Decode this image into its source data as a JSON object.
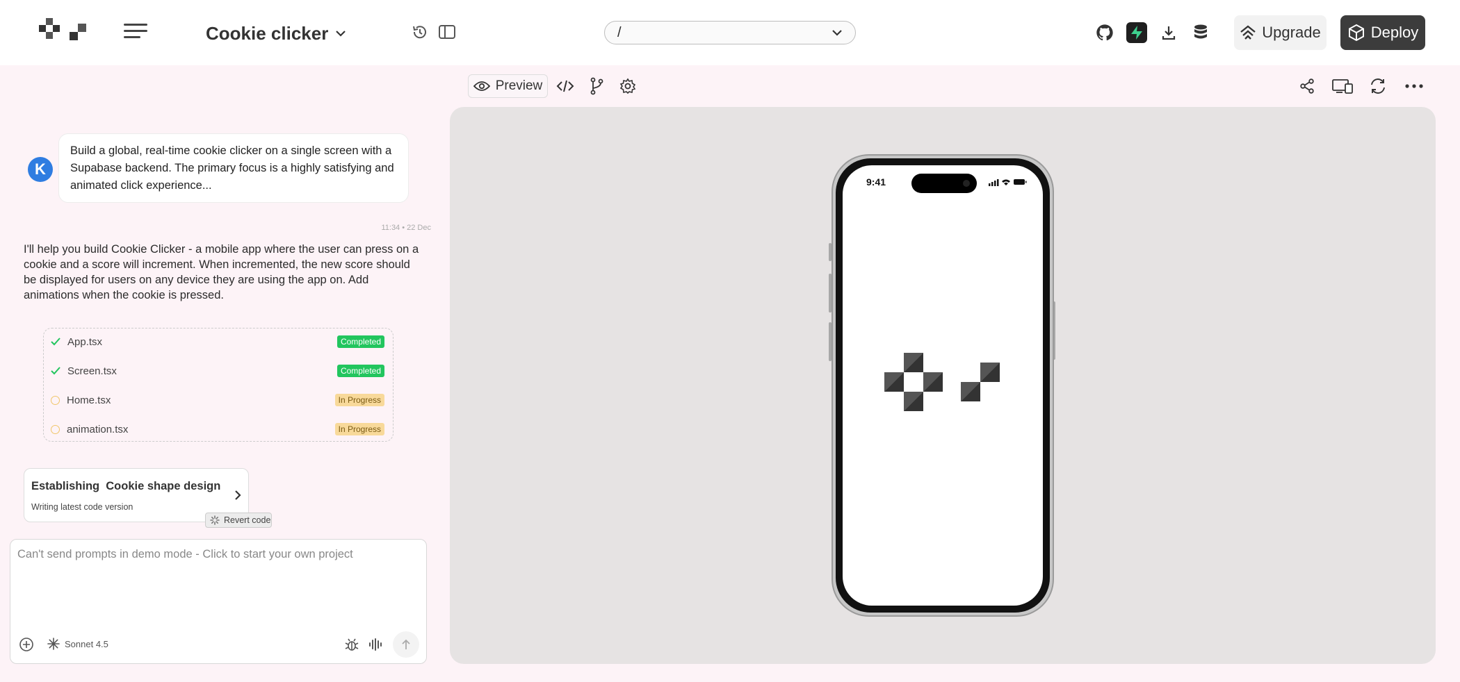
{
  "header": {
    "project_title": "Cookie clicker",
    "path": "/",
    "upgrade_label": "Upgrade",
    "deploy_label": "Deploy"
  },
  "chat": {
    "user_avatar": "K",
    "user_message": "Build a global, real-time cookie clicker on a single screen with a Supabase backend. The primary focus is a highly satisfying and animated click experience...",
    "timestamp": "11:34 • 22 Dec",
    "assistant_message": "I'll help you build Cookie Clicker - a mobile app where the user can press on a cookie and a score will increment. When incremented, the new score should be displayed for users on any device they are using the app on. Add animations when the cookie is pressed.",
    "tasks": [
      {
        "file": "App.tsx",
        "status": "Completed"
      },
      {
        "file": "Screen.tsx",
        "status": "Completed"
      },
      {
        "file": "Home.tsx",
        "status": "In Progress"
      },
      {
        "file": "animation.tsx",
        "status": "In Progress"
      }
    ],
    "status_card": {
      "title": "Establishing  Cookie shape design",
      "subtitle": "Writing latest code version"
    },
    "revert_label": "Revert code"
  },
  "prompt": {
    "placeholder": "Can't send prompts in demo mode - Click to start your own project",
    "model": "Sonnet 4.5"
  },
  "preview": {
    "tab_label": "Preview",
    "phone_time": "9:41"
  },
  "icons": [
    "app-logo-icon",
    "hamburger-icon",
    "chevron-down-icon",
    "history-icon",
    "sidebar-panel-icon",
    "github-icon",
    "supabase-icon",
    "download-icon",
    "database-icon",
    "upgrade-icon",
    "deploy-box-icon",
    "eye-icon",
    "code-icon",
    "git-branch-icon",
    "settings-icon",
    "share-icon",
    "device-icon",
    "refresh-icon",
    "more-icon",
    "check-icon",
    "chevron-right-icon",
    "spinner-icon",
    "plus-icon",
    "sparkle-icon",
    "bug-icon",
    "waveform-icon",
    "arrow-up-icon"
  ],
  "colors": {
    "accent_green": "#22c55e",
    "progress_amber": "#f8d99a",
    "avatar_blue": "#2f7de1",
    "page_bg": "#fdf3f7",
    "canvas_bg": "#e6e3e3",
    "deploy_bg": "#3c3c3c"
  }
}
